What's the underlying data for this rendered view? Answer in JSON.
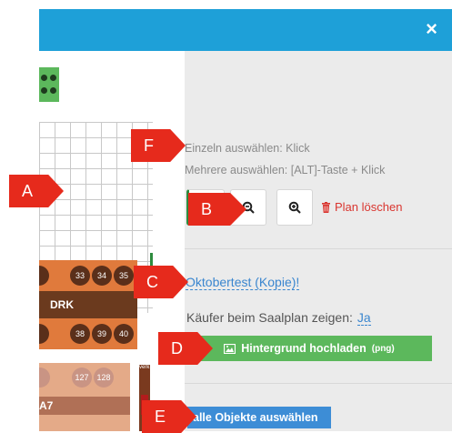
{
  "window": {
    "close_label": "×"
  },
  "info": {
    "line1": "Einzeln auswählen: Klick",
    "line2": "Mehrere auswählen: [ALT]-Taste + Klick"
  },
  "toolbar": {
    "delete_label": "Plan löschen"
  },
  "plan": {
    "title": "Oktobertest (Kopie)!",
    "buyer_label": "Käufer beim Saalplan zeigen:",
    "buyer_value": "Ja",
    "upload_label": "Hintergrund hochladen",
    "upload_hint": "(png)",
    "select_all_label": "alle Objekte auswählen"
  },
  "canvas": {
    "block_drk": {
      "label": "DRK",
      "seats_top": [
        "33",
        "34",
        "35"
      ],
      "seats_bottom": [
        "38",
        "39",
        "40"
      ]
    },
    "block_a7": {
      "label": "A7",
      "seats_top": [
        "127",
        "128"
      ]
    },
    "small_label": "verk"
  },
  "callouts": [
    "A",
    "B",
    "C",
    "D",
    "E",
    "F"
  ],
  "colors": {
    "accent": "#1ea0d8",
    "success": "#5cb85c",
    "danger": "#d9352f",
    "link": "#3a86cf",
    "callout": "#e62a1c"
  }
}
